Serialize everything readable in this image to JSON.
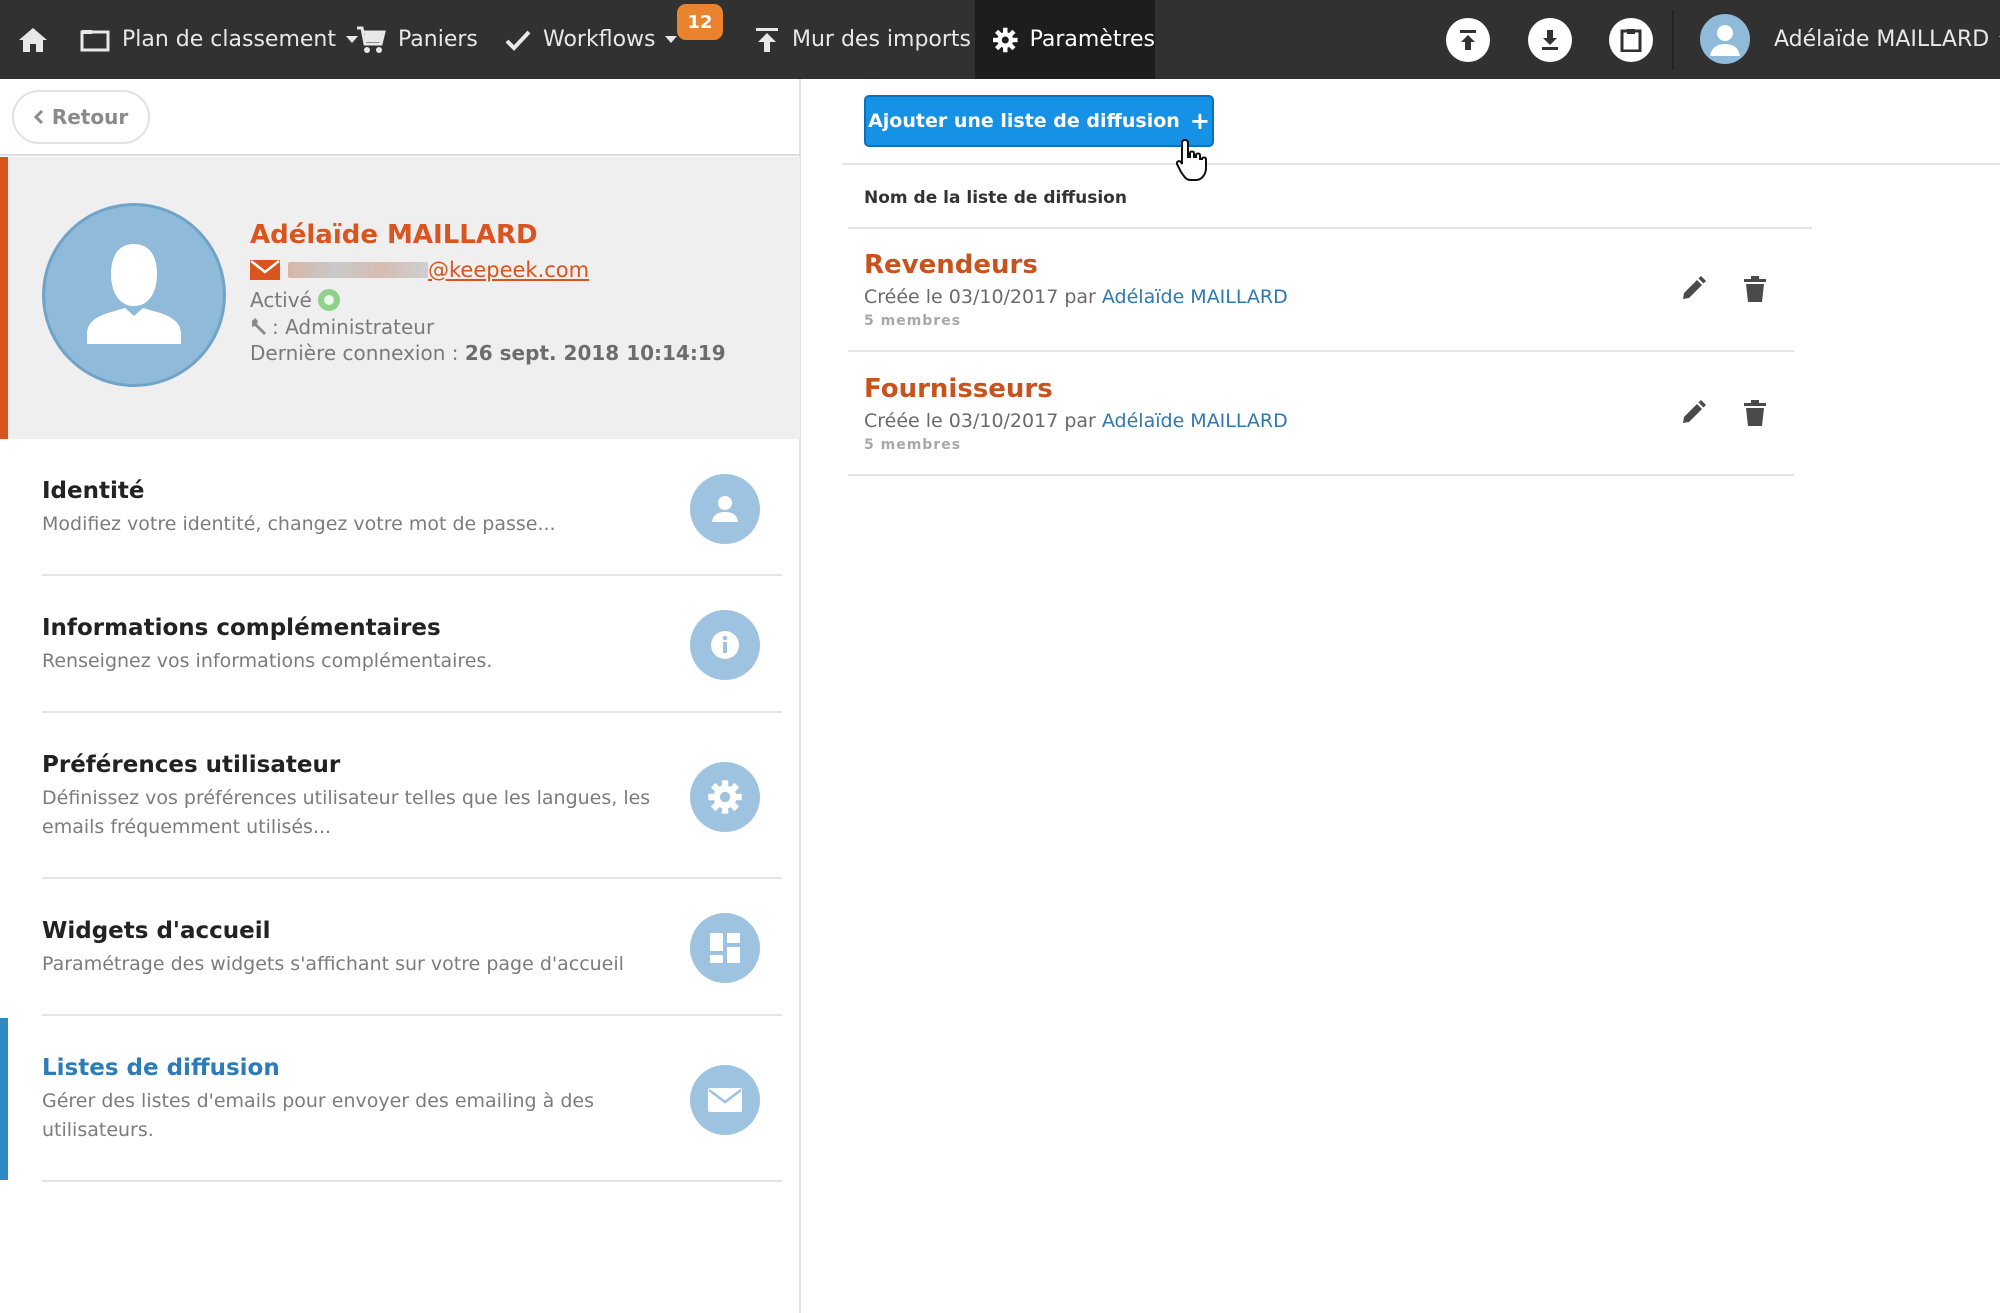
{
  "nav": {
    "home_icon": "home-icon",
    "plan": "Plan de classement",
    "baskets": "Paniers",
    "workflows": "Workflows",
    "workflows_badge": "12",
    "imports": "Mur des imports",
    "settings": "Paramètres",
    "user": "Adélaïde MAILLARD",
    "colors": {
      "bar": "#313131",
      "active": "#1d1d1d",
      "badge": "#e9832d"
    }
  },
  "back": {
    "label": "Retour"
  },
  "profile": {
    "name": "Adélaïde MAILLARD",
    "email_domain": "@keepeek.com",
    "status": "Activé",
    "role": ": Administrateur",
    "last_login_label": "Dernière connexion :",
    "last_login_value": "26 sept. 2018 10:14:19",
    "accent": "#d9541f"
  },
  "menu": [
    {
      "title": "Identité",
      "desc": "Modifiez votre identité, changez votre mot de passe...",
      "icon": "user-icon"
    },
    {
      "title": "Informations complémentaires",
      "desc": "Renseignez vos informations complémentaires.",
      "icon": "info-icon"
    },
    {
      "title": "Préférences utilisateur",
      "desc": "Définissez vos préférences utilisateur telles que les langues, les emails fréquemment utilisés...",
      "icon": "gear-icon"
    },
    {
      "title": "Widgets d'accueil",
      "desc": "Paramétrage des widgets s'affichant sur votre page d'accueil",
      "icon": "widgets-icon"
    },
    {
      "title": "Listes de diffusion",
      "desc": "Gérer des listes d'emails pour envoyer des emailing à des utilisateurs.",
      "icon": "envelope-icon",
      "active": true
    }
  ],
  "main": {
    "add_button": "Ajouter une liste de diffusion",
    "column_header": "Nom de la liste de diffusion",
    "lists": [
      {
        "name": "Revendeurs",
        "created": "Créée le 03/10/2017 par",
        "author": "Adélaïde MAILLARD",
        "members": "5 membres"
      },
      {
        "name": "Fournisseurs",
        "created": "Créée le 03/10/2017 par",
        "author": "Adélaïde MAILLARD",
        "members": "5 membres"
      }
    ],
    "colors": {
      "button": "#1591e6",
      "list_title": "#c8531e",
      "author": "#2f78b0"
    }
  }
}
